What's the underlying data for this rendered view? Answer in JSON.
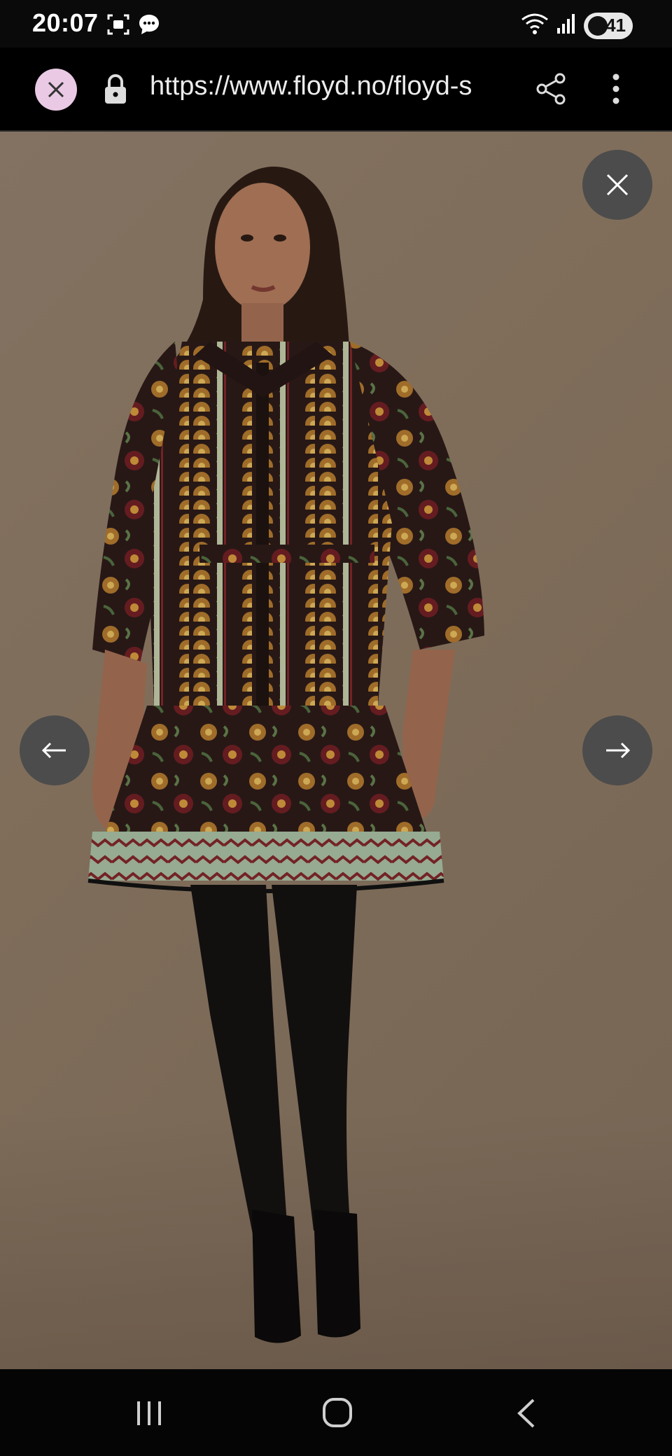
{
  "status_bar": {
    "time": "20:07",
    "battery": "41",
    "left_icons": [
      "screenshot-icon",
      "chat-bubble-icon"
    ],
    "right_icons": [
      "wifi-icon",
      "signal-icon",
      "battery-icon"
    ]
  },
  "browser": {
    "url": "https://www.floyd.no/floyd-s",
    "close_icon": "close-icon",
    "lock_icon": "lock-icon",
    "share_icon": "share-icon",
    "menu_icon": "more-vertical-icon"
  },
  "viewer": {
    "image_alt": "Model wearing a patterned long-sleeve shirt dress with black tights and heels",
    "close_icon": "close-icon",
    "prev_icon": "arrow-left-icon",
    "next_icon": "arrow-right-icon"
  },
  "nav_bar": {
    "icons": [
      "recent-apps-icon",
      "home-icon",
      "back-icon"
    ]
  },
  "colors": {
    "backdrop": "#86735f",
    "control_bg": "#4c4c4c",
    "close_tab_bg": "#e9c9e3"
  }
}
